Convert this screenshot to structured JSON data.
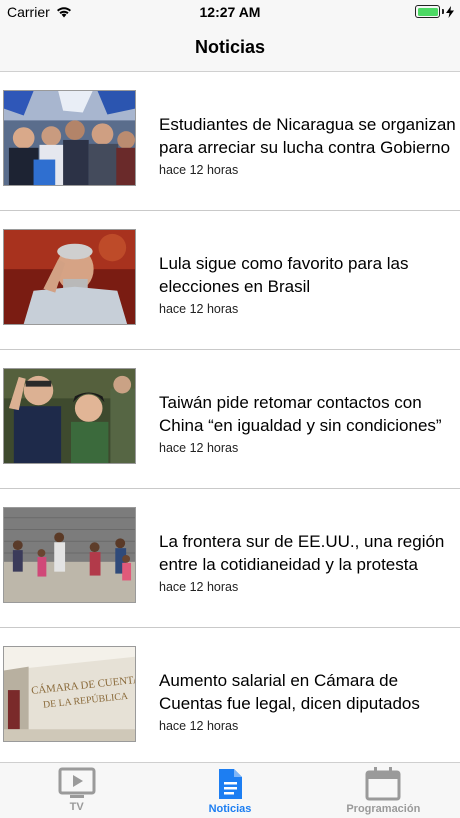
{
  "status_bar": {
    "carrier": "Carrier",
    "time": "12:27 AM"
  },
  "nav": {
    "title": "Noticias"
  },
  "news": [
    {
      "headline": "Estudiantes de Nicaragua se organizan para arreciar su lucha contra Gobierno",
      "time": "hace 12 horas"
    },
    {
      "headline": "Lula sigue como favorito para las elecciones en Brasil",
      "time": "hace 12 horas"
    },
    {
      "headline": "Taiwán pide retomar contactos con China “en igualdad y sin condiciones”",
      "time": "hace 12 horas"
    },
    {
      "headline": "La frontera sur de EE.UU., una región entre la cotidianeidad y la protesta",
      "time": "hace 12 horas"
    },
    {
      "headline": "Aumento salarial en Cámara de Cuentas fue legal, dicen diputados",
      "time": "hace 12 horas"
    }
  ],
  "thumb_sign": {
    "line1": "CÁMARA DE CUENTAS",
    "line2": "DE LA REPÚBLICA"
  },
  "tabs": [
    {
      "label": "TV",
      "icon": "tv-icon"
    },
    {
      "label": "Noticias",
      "icon": "document-icon"
    },
    {
      "label": "Programación",
      "icon": "calendar-icon"
    }
  ],
  "colors": {
    "accent": "#1d7ef2",
    "inactive": "#9a9a9a",
    "battery": "#4cd964"
  }
}
